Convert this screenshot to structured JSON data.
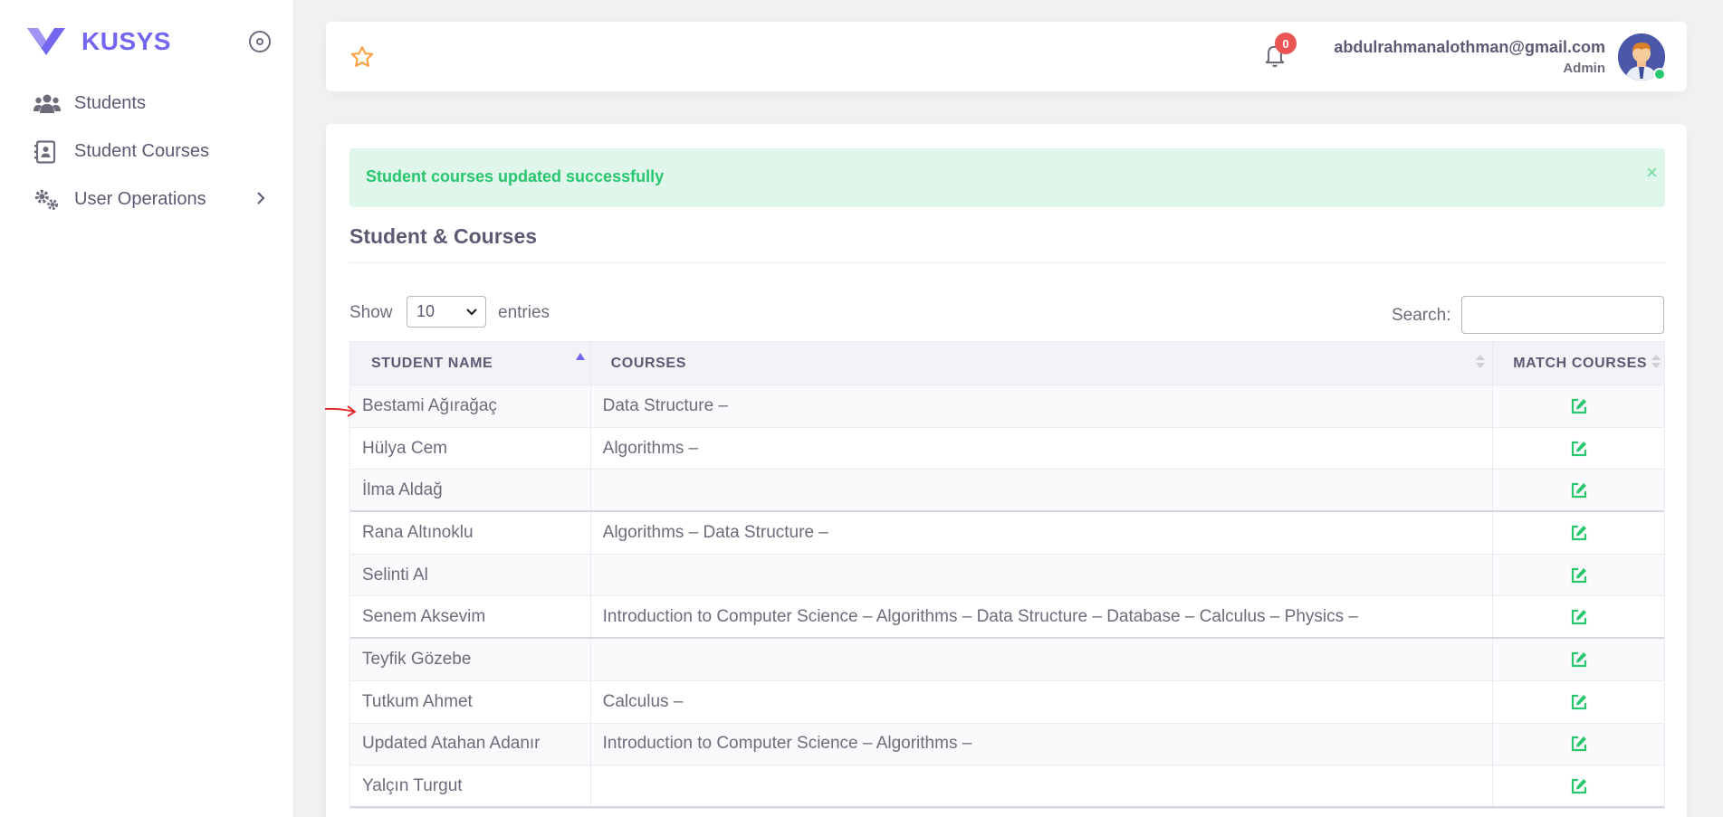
{
  "brand": {
    "name": "KUSYS"
  },
  "sidebar": {
    "items": [
      {
        "label": "Students",
        "icon": "users-icon"
      },
      {
        "label": "Student Courses",
        "icon": "contact-book-icon"
      },
      {
        "label": "User Operations",
        "icon": "gears-icon",
        "has_submenu": true
      }
    ]
  },
  "header": {
    "notifications_count": "0",
    "user_email": "abdulrahmanalothman@gmail.com",
    "user_role": "Admin"
  },
  "alert": {
    "message": "Student courses updated successfully",
    "close_glyph": "×"
  },
  "page": {
    "title": "Student & Courses"
  },
  "table_controls": {
    "show_label": "Show",
    "page_size": "10",
    "entries_label": "entries",
    "search_label": "Search:",
    "search_value": ""
  },
  "table": {
    "columns": [
      "STUDENT NAME",
      "COURSES",
      "MATCH COURSES"
    ],
    "rows": [
      {
        "name": "Bestami Ağırağaç",
        "courses": "Data Structure –"
      },
      {
        "name": "Hülya Cem",
        "courses": "Algorithms –"
      },
      {
        "name": "İlma Aldağ",
        "courses": ""
      },
      {
        "name": "Rana Altınoklu",
        "courses": "Algorithms – Data Structure –"
      },
      {
        "name": "Selinti Al",
        "courses": ""
      },
      {
        "name": "Senem Aksevim",
        "courses": "Introduction to Computer Science – Algorithms – Data Structure – Database – Calculus – Physics –"
      },
      {
        "name": "Teyfik Gözebe",
        "courses": ""
      },
      {
        "name": "Tutkum Ahmet",
        "courses": "Calculus –"
      },
      {
        "name": "Updated Atahan Adanır",
        "courses": "Introduction to Computer Science – Algorithms –"
      },
      {
        "name": "Yalçın Turgut",
        "courses": ""
      }
    ]
  },
  "colors": {
    "brand": "#7367f0",
    "success": "#28c76f",
    "badge": "#ea5455",
    "star": "#ff9f43",
    "annotation_arrow": "#e02020"
  }
}
